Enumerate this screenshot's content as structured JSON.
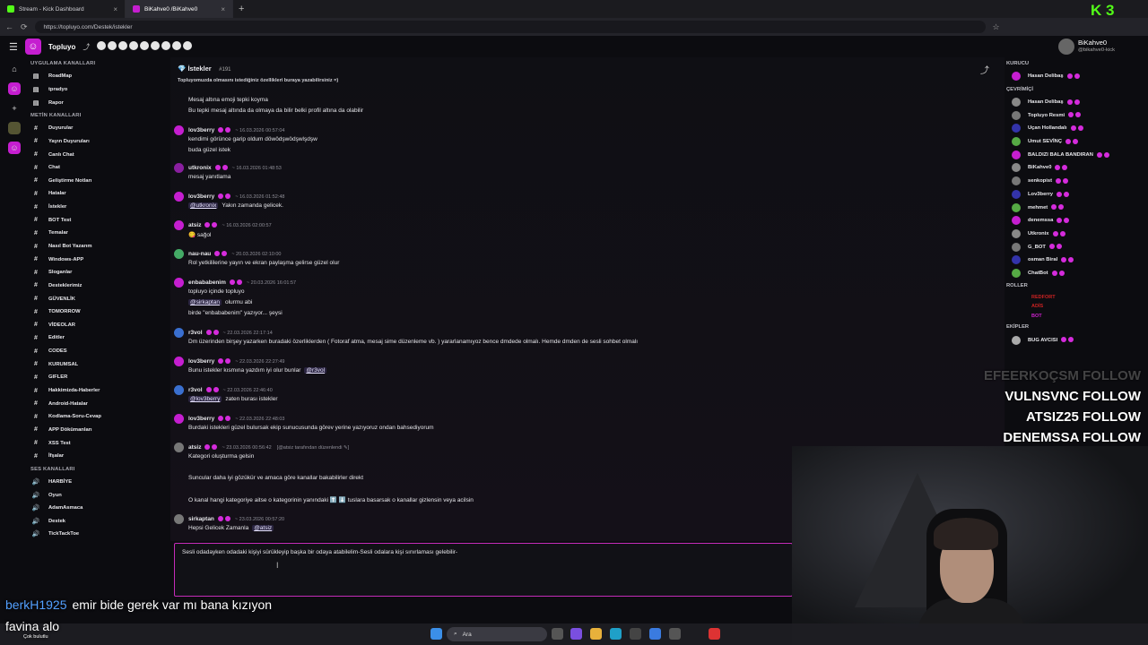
{
  "browser": {
    "tabs": [
      {
        "label": "Stream - Kick Dashboard",
        "color": "#53fc18"
      },
      {
        "label": "BiKahve0 /BiKahve0",
        "color": "#c51ed0"
      }
    ],
    "url": "https://topluyo.com/Destek/istekler"
  },
  "app": {
    "brand": "Topluyo",
    "accent": "#c51ed0"
  },
  "sidebar": {
    "app_section": "UYGULAMA KANALLARI",
    "app_channels": [
      "RoadMap",
      "tpradyo",
      "Rapor"
    ],
    "text_section": "METİN KANALLARI",
    "text_channels": [
      "Duyurular",
      "Yayın Duyuruları",
      "Canlı Chat",
      "Chat",
      "Geliştirme Notları",
      "Hatalar",
      "İstekler",
      "BOT Test",
      "Temalar",
      "Nasıl Bot Yazarım",
      "Windows-APP",
      "Sloganlar",
      "Desteklerimiz",
      "GÜVENLİK",
      "TOMORROW",
      "VİDEOLAR",
      "Editler",
      "CODES",
      "KURUMSAL",
      "GIFLER",
      "Hakkimizda-Haberler",
      "Android-Hatalar",
      "Kodlama-Soru-Cevap",
      "APP Dökümanları",
      "XSS Test",
      "İfşalar"
    ],
    "voice_section": "SES KANALLARI",
    "voice_channels": [
      "HARBİYE",
      "Oyun",
      "AdamAsmaca",
      "Destek",
      "TickTackToe"
    ]
  },
  "channel": {
    "title": "İstekler",
    "number": "#191",
    "description": "Topluyomuzda olmasını istediğiniz özellikleri buraya yazabilirsiniz =)"
  },
  "messages": [
    {
      "user": "",
      "time": "",
      "lines": [
        "Mesaj altına emoji tepki koyma",
        "Bu tepki mesaj altında da olmaya da bilir belki profil altına da olabilir"
      ]
    },
    {
      "user": "lov3berry",
      "time": "~ 16.03.2026 00:57:04",
      "lines": [
        "kendimi görünce garip oldum döwödşwödşwlşdşw",
        "buda güzel istek"
      ]
    },
    {
      "user": "utkronix",
      "time": "~ 16.03.2026 01:48:53",
      "lines": [
        "mesaj yanıtlama"
      ]
    },
    {
      "user": "lov3berry",
      "time": "~ 16.03.2026 01:52:48",
      "mention": "@utkronix",
      "lines": [
        "Yakın zamanda gelicek."
      ]
    },
    {
      "user": "atsiz",
      "time": "~ 16.03.2026 02:00:57",
      "lines": [
        "😋 sağol"
      ]
    },
    {
      "user": "nau-nau",
      "time": "~ 20.03.2026 02:10:00",
      "lines": [
        "Rol yetkililerine yayın ve ekran paylaşma gelirse güzel olur"
      ]
    },
    {
      "user": "enbababenim",
      "time": "~ 20.03.2026 16:01:57",
      "lines": [
        "topluyo içinde topluyo",
        "olurmu abi",
        "birde \"enbababenim\" yazıyor... şeysi"
      ],
      "mention": "@sirkaptan"
    },
    {
      "user": "r3vol",
      "time": "~ 22.03.2026 22:17:14",
      "lines": [
        "Dm üzerinden birşey yazarken buradaki özerliklerden ( Fotoraf atma, mesaj sime düzenleme vb. ) yararlanamıyoz bence dmdede olmalı. Hemde dmden de sesli sohbet olmalı"
      ]
    },
    {
      "user": "lov3berry",
      "time": "~ 22.03.2026 22:27:49",
      "lines": [
        "Bunu istekler kısmına yazdım iyi olur bunlar"
      ],
      "mention": "@r3vol"
    },
    {
      "user": "r3vol",
      "time": "~ 22.03.2026 22:46:40",
      "mention": "@lov3berry",
      "lines": [
        "zaten burası istekler"
      ]
    },
    {
      "user": "lov3berry",
      "time": "~ 22.03.2026 22:48:03",
      "lines": [
        "Burdaki istekleri güzel bulursak ekip sunucusunda görev yerine yazıyoruz ondan bahsediyorum"
      ]
    },
    {
      "user": "atsiz",
      "time": "~ 23.03.2026 00:56:42",
      "edited": "[@atsiz tarafından düzenlendi ✎]",
      "lines": [
        "Kategori oluşturma gelsin",
        "",
        "Suncular daha iyi gözükür ve amaca göre kanallar bakabilirler direkt",
        "",
        "O kanal hangi kategoriye aitse o kategorinin yanındaki ⬆️ ⬇️ tuslara basarsak o kanallar gizlensin veya acilsin"
      ]
    },
    {
      "user": "sirkaptan",
      "time": "~ 23.03.2026 00:57:20",
      "mention": "@atsiz",
      "lines": [
        "Hepsi Gelicek Zamanla"
      ]
    }
  ],
  "composer": {
    "value": "Sesli odadayken odadaki kişiyi sürükleyip başka bir odaya atabilelim-Sesli odalara kişi sınırlaması gelebilir-"
  },
  "profile": {
    "name": "BiKahve0",
    "handle": "@bikahve0-kick"
  },
  "members": {
    "founder_section": "KURUCU",
    "founders": [
      "Hasan Delibaş"
    ],
    "online_section": "ÇEVRİMİÇİ",
    "online": [
      "Hasan Delibaş",
      "Topluyo Resmi",
      "Uçan Hollandalı",
      "Umut SEVİNÇ",
      "BALDIZI BALA BANDIRAN",
      "BiKahve0",
      "senkopist",
      "Lov3berry",
      "mehmet",
      "denemssa",
      "Utkronix",
      "G_BOT",
      "osman Biral",
      "ChatBot"
    ],
    "roles_section": "ROLLER",
    "roles": [
      {
        "name": "REDFORT",
        "color": "#c22"
      },
      {
        "name": "ADİS",
        "color": "#c22"
      },
      {
        "name": "BOT",
        "color": "#c2c"
      }
    ],
    "team_section": "EKİPLER",
    "team": [
      "BUG AVCISI"
    ]
  },
  "stream_overlay": {
    "follows": [
      "EFEERKOÇSM FOLLOW",
      "VULNSVNC FOLLOW",
      "ATSIZ25 FOLLOW",
      "DENEMSSA FOLLOW"
    ],
    "chat": [
      {
        "user": "berkH1925",
        "text": "emir bide gerek var mı bana kızıyon"
      },
      {
        "user": "favina",
        "text": "alo"
      }
    ],
    "sub": "Çok bulutlu",
    "kick_logo": "K 3"
  },
  "taskbar": {
    "search_placeholder": "Ara"
  }
}
